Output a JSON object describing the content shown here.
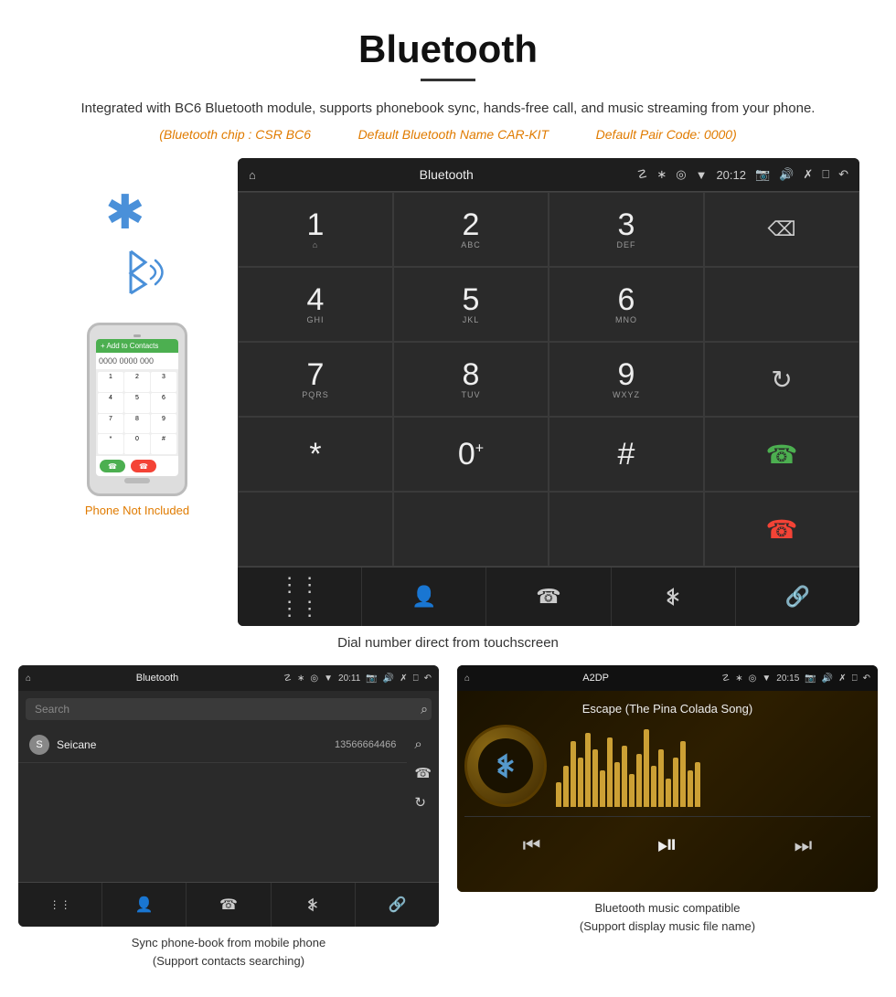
{
  "page": {
    "title": "Bluetooth",
    "underline": true,
    "description": "Integrated with BC6 Bluetooth module, supports phonebook sync, hands-free call, and music streaming from your phone.",
    "specs": {
      "chip": "(Bluetooth chip : CSR BC6",
      "name": "Default Bluetooth Name CAR-KIT",
      "code": "Default Pair Code: 0000)"
    },
    "phone_not_included": "Phone Not Included",
    "dial_caption": "Dial number direct from touchscreen"
  },
  "dialpad_screen": {
    "title": "Bluetooth",
    "time": "20:12",
    "keys": [
      {
        "number": "1",
        "letters": "⌂"
      },
      {
        "number": "2",
        "letters": "ABC"
      },
      {
        "number": "3",
        "letters": "DEF"
      },
      {
        "number": "",
        "letters": "",
        "type": "backspace"
      },
      {
        "number": "4",
        "letters": "GHI"
      },
      {
        "number": "5",
        "letters": "JKL"
      },
      {
        "number": "6",
        "letters": "MNO"
      },
      {
        "number": "",
        "letters": "",
        "type": "empty"
      },
      {
        "number": "7",
        "letters": "PQRS"
      },
      {
        "number": "8",
        "letters": "TUV"
      },
      {
        "number": "9",
        "letters": "WXYZ"
      },
      {
        "number": "",
        "letters": "",
        "type": "refresh"
      },
      {
        "number": "*",
        "letters": ""
      },
      {
        "number": "0",
        "letters": "+",
        "sup": true
      },
      {
        "number": "#",
        "letters": ""
      },
      {
        "number": "",
        "letters": "",
        "type": "call-green"
      },
      {
        "number": "",
        "letters": "",
        "type": "call-red"
      }
    ],
    "bottom_icons": [
      "grid",
      "person",
      "phone",
      "bluetooth",
      "link"
    ]
  },
  "phonebook_screen": {
    "title": "Bluetooth",
    "time": "20:11",
    "search_placeholder": "Search",
    "contacts": [
      {
        "letter": "S",
        "name": "Seicane",
        "phone": "13566664466"
      }
    ],
    "caption": "Sync phone-book from mobile phone\n(Support contacts searching)"
  },
  "music_screen": {
    "title": "A2DP",
    "time": "20:15",
    "song": "Escape (The Pina Colada Song)",
    "caption": "Bluetooth music compatible\n(Support display music file name)"
  },
  "colors": {
    "accent": "#e07b00",
    "android_bg": "#2a2a2a",
    "android_topbar": "#1e1e1e",
    "green": "#4caf50",
    "red": "#f44336",
    "blue": "#4a90d9",
    "gold": "#f5c242"
  }
}
